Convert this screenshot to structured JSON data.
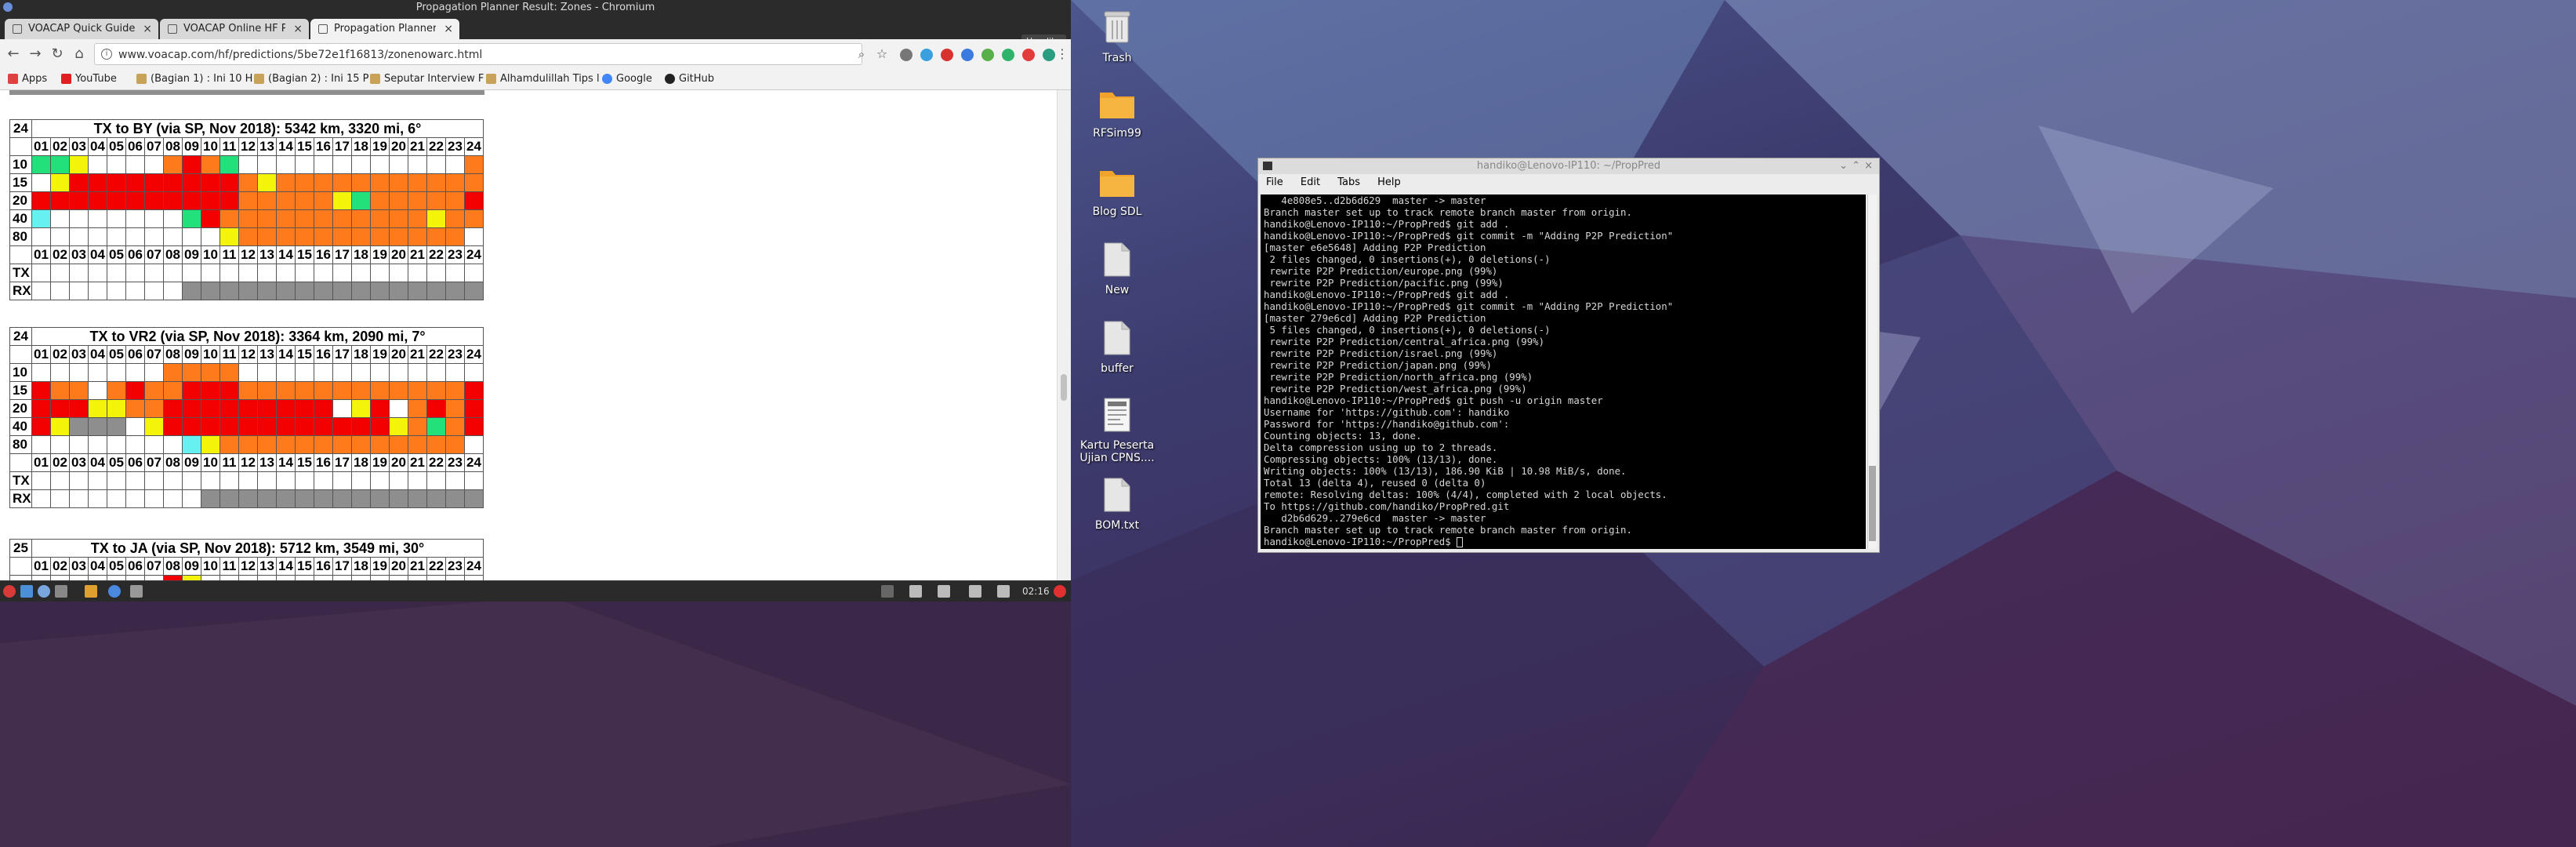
{
  "browser": {
    "window_title": "Propagation Planner Result: Zones - Chromium",
    "tabs": [
      {
        "label": "VOACAP Quick Guide: H"
      },
      {
        "label": "VOACAP Online HF Pred"
      },
      {
        "label": "Propagation Planner Re"
      }
    ],
    "user_badge": "Handika",
    "url": "www.voacap.com/hf/predictions/5be72e1f16813/zonenowarc.html",
    "bookmarks": [
      {
        "label": "Apps",
        "color": "#e04040"
      },
      {
        "label": "YouTube",
        "color": "#e02020"
      },
      {
        "label": "(Bagian 1) : Ini 10 H",
        "color": "#c9a25a"
      },
      {
        "label": "(Bagian 2) : Ini 15 P",
        "color": "#c9a25a"
      },
      {
        "label": "Seputar Interview F",
        "color": "#c9a25a"
      },
      {
        "label": "Alhamdulillah Tips l",
        "color": "#c9a25a"
      },
      {
        "label": "Google",
        "color": "#4285f4"
      },
      {
        "label": "GitHub",
        "color": "#222222"
      }
    ],
    "clock": "02:16"
  },
  "propagation": {
    "hours": [
      "01",
      "02",
      "03",
      "04",
      "05",
      "06",
      "07",
      "08",
      "09",
      "10",
      "11",
      "12",
      "13",
      "14",
      "15",
      "16",
      "17",
      "18",
      "19",
      "20",
      "21",
      "22",
      "23",
      "24"
    ],
    "tables": [
      {
        "zone": "24",
        "title": "TX to BY (via SP, Nov 2018): 5342 km, 3320 mi, 6°",
        "rows": [
          {
            "label": "10",
            "cells": "GGYWWWWOROGWWWWWWWWWWWWO"
          },
          {
            "label": "15",
            "cells": "WYRRRRRRRRROYOOOOOOOOOOO"
          },
          {
            "label": "20",
            "cells": "RRRRRRRRRRROOOOOYGOOOOOR"
          },
          {
            "label": "40",
            "cells": "CWWWWWWWGROOOOOOOOOOOYOO"
          },
          {
            "label": "80",
            "cells": "WWWWWWWWWWYOOOOOOOOOOOOW"
          }
        ],
        "tx": "WWWWWWWWWWWWWWWWWWWWWWWW",
        "rx": "WWWWWWWWXXXXXXXXXXXXXXXX"
      },
      {
        "zone": "24",
        "title": "TX to VR2 (via SP, Nov 2018): 3364 km, 2090 mi, 7°",
        "rows": [
          {
            "label": "10",
            "cells": "WWWWWWWOOOOWWWWWWWWWWWWW"
          },
          {
            "label": "15",
            "cells": "ROOWOROORRROOOOOOOOOOOOR"
          },
          {
            "label": "20",
            "cells": "RRRYYOORRRRRRRRRWYRWOROR"
          },
          {
            "label": "40",
            "cells": "RYXXXWYRRRRRRRRRRRRYOGOR"
          },
          {
            "label": "80",
            "cells": "WWWWWWWWCYOOOOOOOOOOOOOW"
          }
        ],
        "tx": "WWWWWWWWWWWWWWWWWWWWWWWW",
        "rx": "WWWWWWWWWXXXXXXXXXXXXXXX"
      },
      {
        "zone": "25",
        "title": "TX to JA (via SP, Nov 2018): 5712 km, 3549 mi, 30°",
        "rows": [],
        "tx": "",
        "rx": ""
      }
    ]
  },
  "desktop_icons": [
    {
      "label": "Trash"
    },
    {
      "label": "RFSim99"
    },
    {
      "label": "Blog SDL"
    },
    {
      "label": "New"
    },
    {
      "label": "buffer"
    },
    {
      "label": "Kartu Peserta Ujian CPNS...."
    },
    {
      "label": "BOM.txt"
    }
  ],
  "terminal": {
    "title": "handiko@Lenovo-IP110: ~/PropPred",
    "menu": [
      "File",
      "Edit",
      "Tabs",
      "Help"
    ],
    "lines": [
      "   4e808e5..d2b6d629  master -> master",
      "Branch master set up to track remote branch master from origin.",
      "handiko@Lenovo-IP110:~/PropPred$ git add .",
      "handiko@Lenovo-IP110:~/PropPred$ git commit -m \"Adding P2P Prediction\"",
      "[master e6e5648] Adding P2P Prediction",
      " 2 files changed, 0 insertions(+), 0 deletions(-)",
      " rewrite P2P Prediction/europe.png (99%)",
      " rewrite P2P Prediction/pacific.png (99%)",
      "handiko@Lenovo-IP110:~/PropPred$ git add .",
      "handiko@Lenovo-IP110:~/PropPred$ git commit -m \"Adding P2P Prediction\"",
      "[master 279e6cd] Adding P2P Prediction",
      " 5 files changed, 0 insertions(+), 0 deletions(-)",
      " rewrite P2P Prediction/central_africa.png (99%)",
      " rewrite P2P Prediction/israel.png (99%)",
      " rewrite P2P Prediction/japan.png (99%)",
      " rewrite P2P Prediction/north_africa.png (99%)",
      " rewrite P2P Prediction/west_africa.png (99%)",
      "handiko@Lenovo-IP110:~/PropPred$ git push -u origin master",
      "Username for 'https://github.com': handiko",
      "Password for 'https://handiko@github.com':",
      "Counting objects: 13, done.",
      "Delta compression using up to 2 threads.",
      "Compressing objects: 100% (13/13), done.",
      "Writing objects: 100% (13/13), 186.90 KiB | 10.98 MiB/s, done.",
      "Total 13 (delta 4), reused 0 (delta 0)",
      "remote: Resolving deltas: 100% (4/4), completed with 2 local objects.",
      "To https://github.com/handiko/PropPred.git",
      "   d2b6d629..279e6cd  master -> master",
      "Branch master set up to track remote branch master from origin.",
      "handiko@Lenovo-IP110:~/PropPred$ "
    ]
  },
  "colors": {
    "W": "#ffffff",
    "G": "#22e07a",
    "Y": "#f4f40a",
    "O": "#ff7a1a",
    "R": "#f20000",
    "C": "#66f0f0",
    "X": "#8e8e8e"
  }
}
